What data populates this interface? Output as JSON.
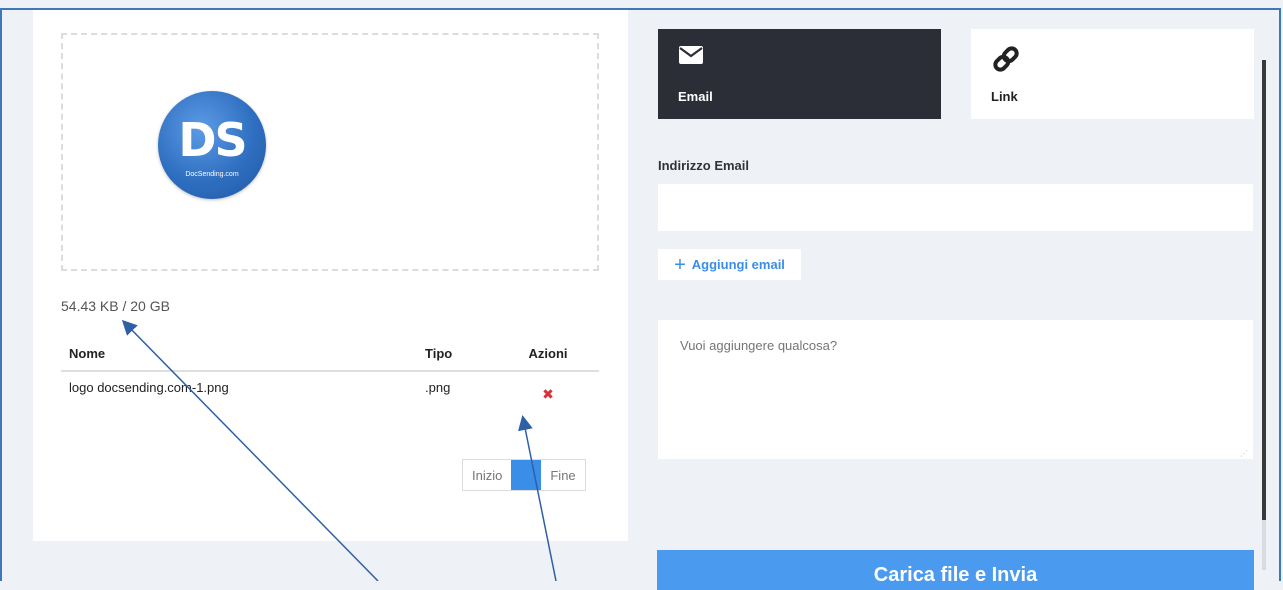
{
  "preview": {
    "logo_text": "DS",
    "logo_subtext": "DocSending.com",
    "brand_color": "#2f6fc0"
  },
  "usage_text": "54.43 KB / 20 GB",
  "table": {
    "headers": {
      "name": "Nome",
      "type": "Tipo",
      "actions": "Azioni"
    },
    "rows": [
      {
        "name": "logo docsending.com-1.png",
        "type": ".png",
        "action_icon": "delete-icon"
      }
    ]
  },
  "pager": {
    "first": "Inizio",
    "current": "",
    "last": "Fine"
  },
  "tabs": {
    "email": {
      "label": "Email",
      "icon": "envelope-icon"
    },
    "link": {
      "label": "Link",
      "icon": "link-icon"
    }
  },
  "email_section": {
    "label": "Indirizzo Email",
    "input_value": "",
    "add_button": "Aggiungi email"
  },
  "message": {
    "placeholder": "Vuoi aggiungere qualcosa?"
  },
  "submit_button": "Carica file e Invia",
  "colors": {
    "accent": "#3a8ee8",
    "dark_tab": "#2b2e37",
    "delete": "#d9303a",
    "annotation_arrow": "#2f5fa7"
  }
}
